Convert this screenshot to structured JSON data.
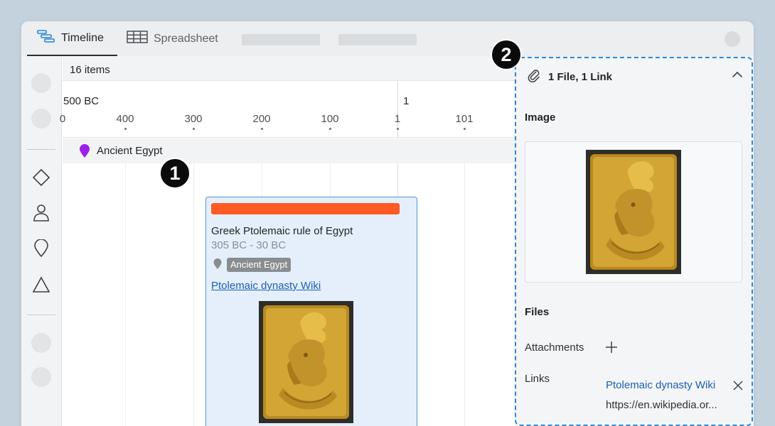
{
  "tabs": [
    {
      "label": "Timeline",
      "icon": "timeline-icon",
      "active": true
    },
    {
      "label": "Spreadsheet",
      "icon": "spreadsheet-icon",
      "active": false
    }
  ],
  "timeline": {
    "item_count": "16 items",
    "era_left": "500 BC",
    "era_right": "1",
    "ticks": [
      "0",
      "400",
      "300",
      "200",
      "100",
      "1",
      "101"
    ],
    "group": {
      "label": "Ancient Egypt",
      "pin_color": "#9b1fe8"
    }
  },
  "event": {
    "bar_color": "#ff5a24",
    "title": "Greek Ptolemaic rule of Egypt",
    "dates": "305 BC - 30 BC",
    "tag": "Ancient Egypt",
    "link": "Ptolemaic dynasty Wiki"
  },
  "panel": {
    "header": "1 File, 1 Link",
    "image_section": "Image",
    "files_section": "Files",
    "attachments_label": "Attachments",
    "links_label": "Links",
    "link_title": "Ptolemaic dynasty Wiki",
    "link_url": "https://en.wikipedia.or..."
  },
  "badges": {
    "one": "1",
    "two": "2"
  },
  "colors": {
    "accent": "#2a86d8",
    "link": "#1b5fb8",
    "card_bg": "#e4effb"
  }
}
